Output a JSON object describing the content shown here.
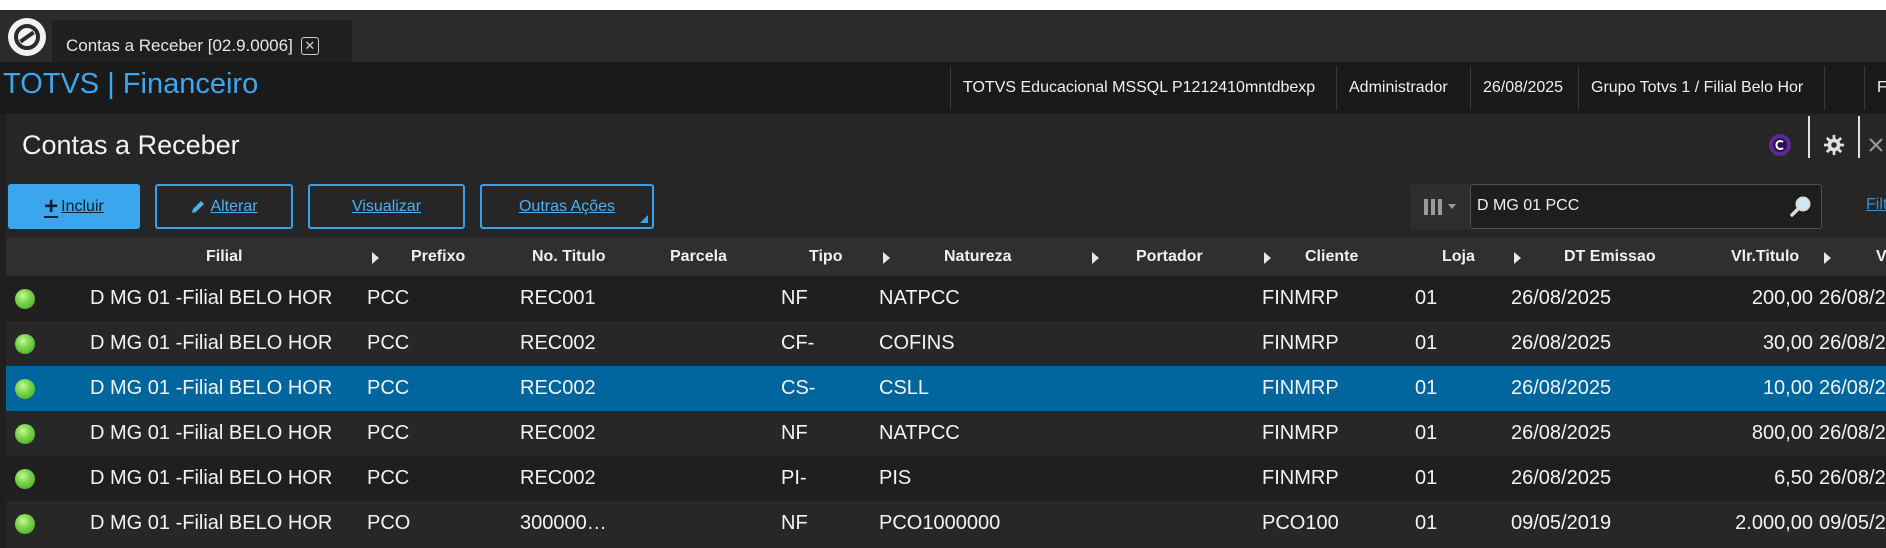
{
  "tab": {
    "label": "Contas a Receber [02.9.0006]",
    "close_symbol": "✕"
  },
  "app": {
    "title": "TOTVS | Financeiro"
  },
  "info_bar": {
    "environment": "TOTVS Educacional MSSQL P1212410mntdbexp",
    "user": "Administrador",
    "date": "26/08/2025",
    "branch": "Grupo Totvs 1 / Filial Belo Hor",
    "extra": "F"
  },
  "page": {
    "title": "Contas a Receber"
  },
  "toolbar": {
    "include_label": "Incluir",
    "include_plus": "+",
    "edit_label": "Alterar",
    "view_label": "Visualizar",
    "other_label": "Outras Ações"
  },
  "search": {
    "value": "D MG 01 PCC",
    "filter_label": "Filt"
  },
  "columns": {
    "filial": "Filial",
    "prefixo": "Prefixo",
    "titulo": "No. Titulo",
    "parcela": "Parcela",
    "tipo": "Tipo",
    "natureza": "Natureza",
    "portador": "Portador",
    "cliente": "Cliente",
    "loja": "Loja",
    "emissao": "DT Emissao",
    "valor": "Vlr.Titulo",
    "vencimento": "V"
  },
  "rows": [
    {
      "filial": "D MG 01 -Filial BELO HOR",
      "prefixo": "PCC",
      "titulo": "REC001",
      "parcela": "",
      "tipo": "NF",
      "natureza": "NATPCC",
      "portador": "",
      "cliente": "FINMRP",
      "loja": "01",
      "emissao": "26/08/2025",
      "valor": "200,00",
      "vencimento": "26/08/2"
    },
    {
      "filial": "D MG 01 -Filial BELO HOR",
      "prefixo": "PCC",
      "titulo": "REC002",
      "parcela": "",
      "tipo": "CF-",
      "natureza": "COFINS",
      "portador": "",
      "cliente": "FINMRP",
      "loja": "01",
      "emissao": "26/08/2025",
      "valor": "30,00",
      "vencimento": "26/08/2"
    },
    {
      "filial": "D MG 01 -Filial BELO HOR",
      "prefixo": "PCC",
      "titulo": "REC002",
      "parcela": "",
      "tipo": "CS-",
      "natureza": "CSLL",
      "portador": "",
      "cliente": "FINMRP",
      "loja": "01",
      "emissao": "26/08/2025",
      "valor": "10,00",
      "vencimento": "26/08/2"
    },
    {
      "filial": "D MG 01 -Filial BELO HOR",
      "prefixo": "PCC",
      "titulo": "REC002",
      "parcela": "",
      "tipo": "NF",
      "natureza": "NATPCC",
      "portador": "",
      "cliente": "FINMRP",
      "loja": "01",
      "emissao": "26/08/2025",
      "valor": "800,00",
      "vencimento": "26/08/2"
    },
    {
      "filial": "D MG 01 -Filial BELO HOR",
      "prefixo": "PCC",
      "titulo": "REC002",
      "parcela": "",
      "tipo": "PI-",
      "natureza": "PIS",
      "portador": "",
      "cliente": "FINMRP",
      "loja": "01",
      "emissao": "26/08/2025",
      "valor": "6,50",
      "vencimento": "26/08/2"
    },
    {
      "filial": "D MG 01 -Filial BELO HOR",
      "prefixo": "PCO",
      "titulo": "300000…",
      "parcela": "",
      "tipo": "NF",
      "natureza": "PCO1000000",
      "portador": "",
      "cliente": "PCO100",
      "loja": "01",
      "emissao": "09/05/2019",
      "valor": "2.000,00",
      "vencimento": "09/05/2"
    }
  ],
  "selected_row": 2,
  "colors": {
    "accent": "#3aa6ee",
    "selected_row": "#01669e",
    "status_ok": "#7ad64a",
    "app_title": "#3ea6ee"
  }
}
